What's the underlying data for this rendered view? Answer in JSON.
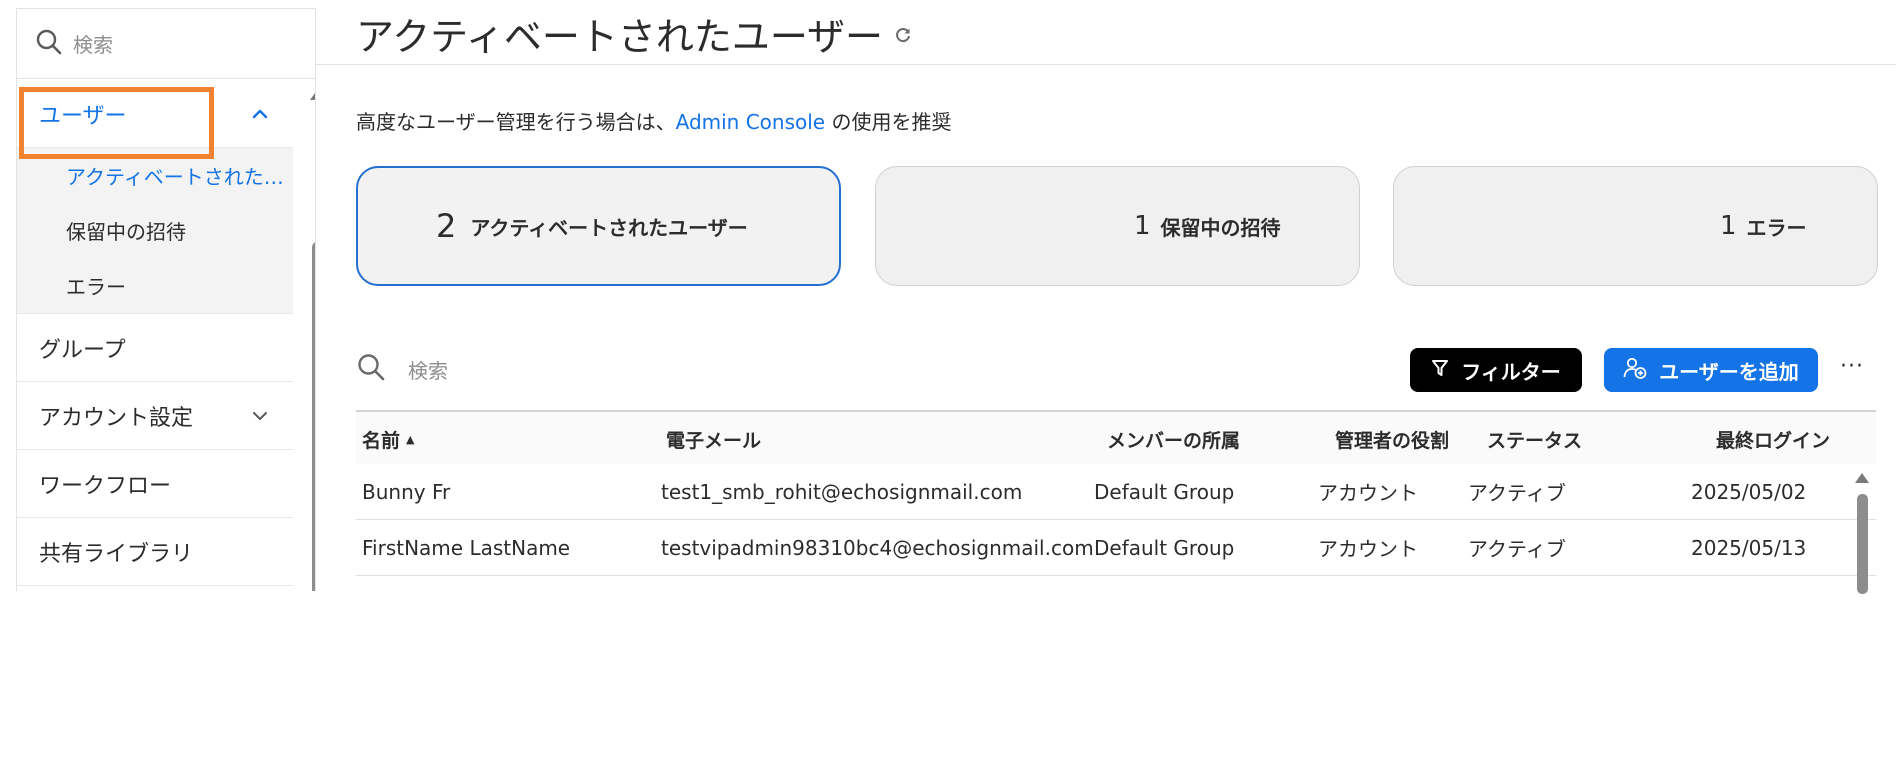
{
  "sidebar": {
    "search_placeholder": "検索",
    "items": [
      {
        "label": "ユーザー",
        "expanded": true
      },
      {
        "label": "グループ"
      },
      {
        "label": "アカウント設定",
        "expandable": true
      },
      {
        "label": "ワークフロー"
      },
      {
        "label": "共有ライブラリ"
      }
    ],
    "sub_items": [
      {
        "label": "アクティベートされた…",
        "active": true
      },
      {
        "label": "保留中の招待"
      },
      {
        "label": "エラー"
      }
    ]
  },
  "main": {
    "title": "アクティベートされたユーザー",
    "recommend_prefix": "高度なユーザー管理を行う場合は、",
    "recommend_link": "Admin Console",
    "recommend_suffix": " の使用を推奨",
    "cards": [
      {
        "count": "2",
        "label": "アクティベートされたユーザー"
      },
      {
        "count": "1",
        "label": "保留中の招待"
      },
      {
        "count": "1",
        "label": "エラー"
      }
    ],
    "search_placeholder": "検索",
    "filter_label": "フィルター",
    "add_user_label": "ユーザーを追加",
    "more_label": "···"
  },
  "table": {
    "columns": [
      "名前",
      "電子メール",
      "メンバーの所属",
      "管理者の役割",
      "ステータス",
      "最終ログイン"
    ],
    "rows": [
      [
        "Bunny Fr",
        "test1_smb_rohit@echosignmail.com",
        "Default Group",
        "アカウント",
        "アクティブ",
        "2025/05/02"
      ],
      [
        "FirstName LastName",
        "testvipadmin98310bc4@echosignmail.com",
        "Default Group",
        "アカウント",
        "アクティブ",
        "2025/05/13"
      ]
    ]
  },
  "colors": {
    "accent": "#1473e6",
    "highlight": "#f28230",
    "selected_card_border": "#2470d0"
  }
}
